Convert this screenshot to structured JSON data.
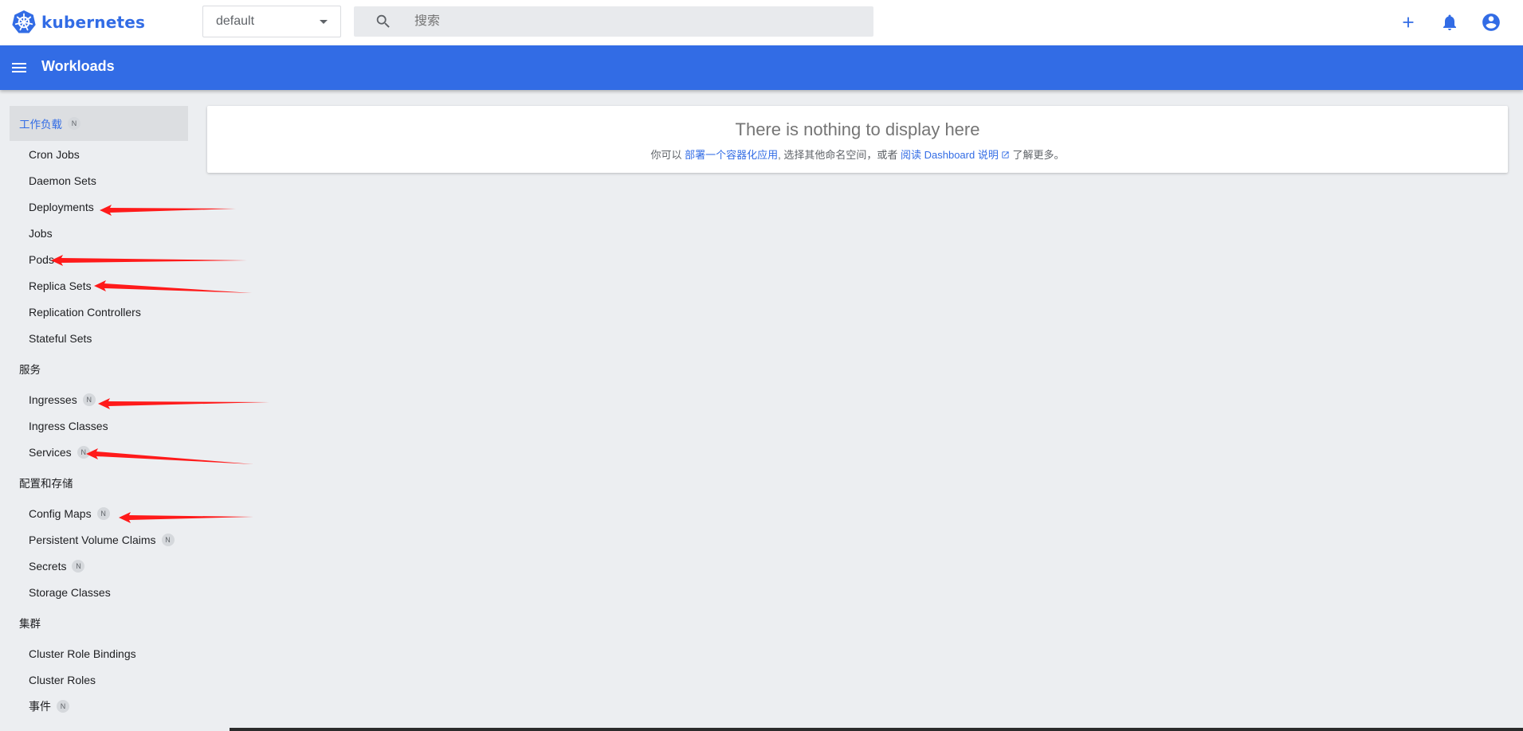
{
  "topbar": {
    "brand": "kubernetes",
    "namespace": "default",
    "search_placeholder": "搜索",
    "icons": [
      "add-icon",
      "notifications-icon",
      "account-icon"
    ]
  },
  "titlebar": {
    "title": "Workloads"
  },
  "sidebar": {
    "sections": [
      {
        "label": "工作负载",
        "badge": "N",
        "active": true,
        "items": [
          {
            "label": "Cron Jobs"
          },
          {
            "label": "Daemon Sets"
          },
          {
            "label": "Deployments"
          },
          {
            "label": "Jobs"
          },
          {
            "label": "Pods"
          },
          {
            "label": "Replica Sets"
          },
          {
            "label": "Replication Controllers"
          },
          {
            "label": "Stateful Sets"
          }
        ]
      },
      {
        "label": "服务",
        "items": [
          {
            "label": "Ingresses",
            "badge": "N"
          },
          {
            "label": "Ingress Classes"
          },
          {
            "label": "Services",
            "badge": "N"
          }
        ]
      },
      {
        "label": "配置和存储",
        "items": [
          {
            "label": "Config Maps",
            "badge": "N"
          },
          {
            "label": "Persistent Volume Claims",
            "badge": "N"
          },
          {
            "label": "Secrets",
            "badge": "N"
          },
          {
            "label": "Storage Classes"
          }
        ]
      },
      {
        "label": "集群",
        "items": [
          {
            "label": "Cluster Role Bindings"
          },
          {
            "label": "Cluster Roles"
          },
          {
            "label": "事件",
            "badge": "N"
          }
        ]
      }
    ]
  },
  "empty_state": {
    "title": "There is nothing to display here",
    "text_prefix": "你可以",
    "link_deploy": "部署一个容器化应用",
    "text_middle": ", 选择其他命名空间，或者",
    "link_docs": "阅读 Dashboard 说明",
    "text_suffix": "了解更多。"
  },
  "colors": {
    "brand": "#326ce5",
    "titlebar": "#326ce5",
    "background": "#eceef1",
    "annotation_arrow": "#ff1a1a"
  }
}
